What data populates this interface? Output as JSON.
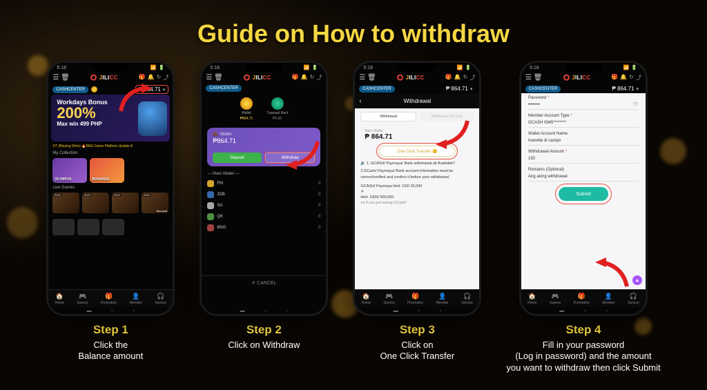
{
  "title": "Guide on How to withdraw",
  "common": {
    "balance": "₱ 864.71",
    "balance_plain": "864.71",
    "logo_j": "J",
    "logo_ili": "ILI",
    "logo_cc": "CC",
    "nav": {
      "home": "Home",
      "games": "Games",
      "promo": "Promotion",
      "member": "Member",
      "service": "Service"
    },
    "cashcenter": "CASHCENTER"
  },
  "step1": {
    "label": "Step 1",
    "caption": "Click the\nBalance amount",
    "promo_title": "Workdays Bonus",
    "promo_pct": "200%",
    "promo_sub": "Max win 499 PHP",
    "ticker": "OT (Blazing Wins)    🔥BNG Game Platform Update A",
    "my_collection": "My Collection",
    "live_games": "Live Games",
    "thumbs": {
      "olympus": "OLYMPUS",
      "bonanza": "BONANZA"
    },
    "live": {
      "evo": "EVO",
      "baccarat": "Baccarat"
    }
  },
  "step2": {
    "label": "Step 2",
    "caption": "Click on Withdraw",
    "tabs": {
      "wallet": "Wallet",
      "wallet_amt": "₱864.71",
      "transact": "Transact Rect",
      "transact_amt": "₱0.00"
    },
    "card_label": "Wallet",
    "card_amt": "₱864.71",
    "deposit": "Deposit",
    "withdraw": "Withdraw",
    "main_wallet": "Main Wallet",
    "cancel": "✕ CANCEL",
    "providers": [
      {
        "name": "FM",
        "amt": "0"
      },
      {
        "name": "JDB",
        "amt": "0"
      },
      {
        "name": "SA",
        "amt": "0"
      },
      {
        "name": "QK",
        "amt": "0"
      },
      {
        "name": "BNG",
        "amt": "0"
      }
    ]
  },
  "step3": {
    "label": "Step 3",
    "caption": "Click on\nOne Click Transfer",
    "header": "Withdrawal",
    "tab_withdrawal": "Withdrawal",
    "tab_records": "Withdrawal Records",
    "main_wallet": "Main Wallet",
    "mw_amt": "₱ 864.71",
    "transfer_btn": "One Click Transfer 😊",
    "notice1": "🔊 1. GCASH/ Paymaya/ Bank withdrawal all Available!!",
    "notice2": "2.GCash/ Paymaya/ Bank account information must be correct/verified and confirm it before your withdrawal.",
    "limit1": "GCASH/ Paymaya limit: 100/ 20,000",
    "limit2": "limit: 1000/ 500,000",
    "footer_note": "us if you put wrong GCash/",
    "close": "✕"
  },
  "step4": {
    "label": "Step 4",
    "caption": "Fill in your password\n(Log in password) and the amount\nyou want to withdraw then click Submit",
    "password_label": "Password",
    "password_val": "••••••••",
    "acct_type_label": "Member Account Type",
    "acct_type_val": "GCASH 0945********",
    "wallet_name_label": "Wallet Account Name",
    "wallet_name_val": "Ivanette di campo",
    "amount_label": "Withdrawal Amount",
    "amount_val": "150",
    "remarks_label": "Remarks (Optional)",
    "remarks_val": "Ang aking withdrawal",
    "submit": "Submit"
  }
}
